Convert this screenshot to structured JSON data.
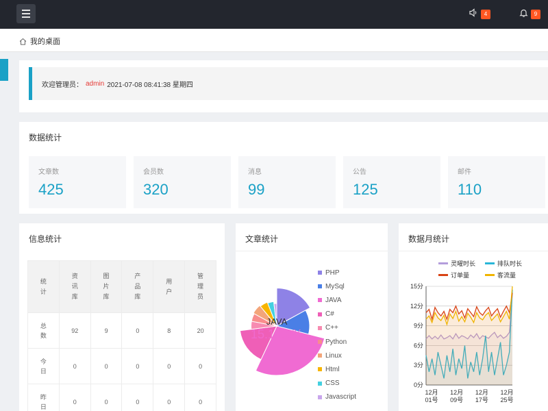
{
  "header": {
    "speaker_badge": "4",
    "bell_badge": "9"
  },
  "breadcrumb": {
    "label": "我的桌面"
  },
  "welcome": {
    "prefix": "欢迎管理员：",
    "user": "admin",
    "datetime": "2021-07-08  08:41:38  星期四"
  },
  "data_stats": {
    "title": "数据统计",
    "cards": [
      {
        "label": "文章数",
        "value": "425"
      },
      {
        "label": "会员数",
        "value": "320"
      },
      {
        "label": "消息",
        "value": "99"
      },
      {
        "label": "公告",
        "value": "125"
      },
      {
        "label": "邮件",
        "value": "110"
      }
    ]
  },
  "info_stats": {
    "title": "信息统计",
    "headers": [
      "统计",
      "资讯库",
      "图片库",
      "产品库",
      "用户",
      "管理员"
    ],
    "rows": [
      {
        "label": "总数",
        "values": [
          "92",
          "9",
          "0",
          "8",
          "20"
        ]
      },
      {
        "label": "今日",
        "values": [
          "0",
          "0",
          "0",
          "0",
          "0"
        ]
      },
      {
        "label": "昨日",
        "values": [
          "0",
          "0",
          "0",
          "0",
          "0"
        ]
      }
    ]
  },
  "chart_data": [
    {
      "type": "pie",
      "title": "文章统计",
      "center_label": "JAVA",
      "center_value": "15.14.8%",
      "legend": [
        "PHP",
        "MySql",
        "JAVA",
        "C#",
        "C++",
        "Python",
        "Linux",
        "Html",
        "CSS",
        "Javascript"
      ],
      "colors": [
        "#8e82e6",
        "#4a7fe6",
        "#f06bd2",
        "#ef5fb7",
        "#f78bb1",
        "#f88d8d",
        "#f3a57a",
        "#f7b500",
        "#45d0e0",
        "#c9a6ec"
      ],
      "values": [
        17,
        12,
        28,
        16,
        5,
        5,
        6,
        5,
        4,
        2
      ]
    },
    {
      "type": "line",
      "title": "数据月统计",
      "series": [
        {
          "name": "灵曜时长",
          "color": "#b39ddb",
          "values": [
            7,
            7.5,
            7,
            7.4,
            7,
            7.6,
            7,
            7.2,
            7.5,
            7,
            7.8,
            7.1,
            7.5,
            7.3,
            7,
            7.6,
            7.2,
            7.8,
            7,
            7.5,
            7.3,
            7.1,
            7.6,
            8,
            7.2,
            7.6,
            7.1,
            7.4,
            8,
            14
          ]
        },
        {
          "name": "排队时长",
          "color": "#29b6d8",
          "values": [
            4.5,
            2,
            4,
            1.5,
            5,
            3,
            1,
            4.5,
            2,
            5.5,
            1.5,
            4,
            2.5,
            6,
            1,
            3.5,
            2,
            5,
            1.5,
            4,
            7.5,
            2,
            5,
            1.5,
            4,
            6.5,
            1.5,
            3,
            5,
            14.5
          ]
        },
        {
          "name": "订单量",
          "color": "#d84315",
          "values": [
            11,
            11.5,
            10,
            11.8,
            11,
            10.5,
            11.2,
            10,
            11.5,
            11,
            12,
            10.8,
            11.3,
            10.2,
            11.6,
            11,
            10.4,
            11.9,
            11,
            10.6,
            11.3,
            11.8,
            10.5,
            11.1,
            11.6,
            10.3,
            11.2,
            12,
            11,
            14
          ]
        },
        {
          "name": "客流量",
          "color": "#f0b400",
          "values": [
            10,
            10.5,
            9.5,
            11,
            10.2,
            9.8,
            10.6,
            9.2,
            10.8,
            10.1,
            11.2,
            9.7,
            10.4,
            9.6,
            10.9,
            10.3,
            9.5,
            11,
            10.2,
            9.9,
            10.6,
            11,
            9.8,
            10.3,
            10.8,
            9.6,
            10.4,
            11.2,
            10,
            15
          ]
        }
      ],
      "y_ticks": [
        "15分",
        "12分",
        "9分",
        "6分",
        "3分",
        "0分"
      ],
      "ylim": [
        0,
        15
      ],
      "x_ticks": [
        "12月\n01号",
        "12月\n09号",
        "12月\n17号",
        "12月\n25号"
      ]
    }
  ]
}
